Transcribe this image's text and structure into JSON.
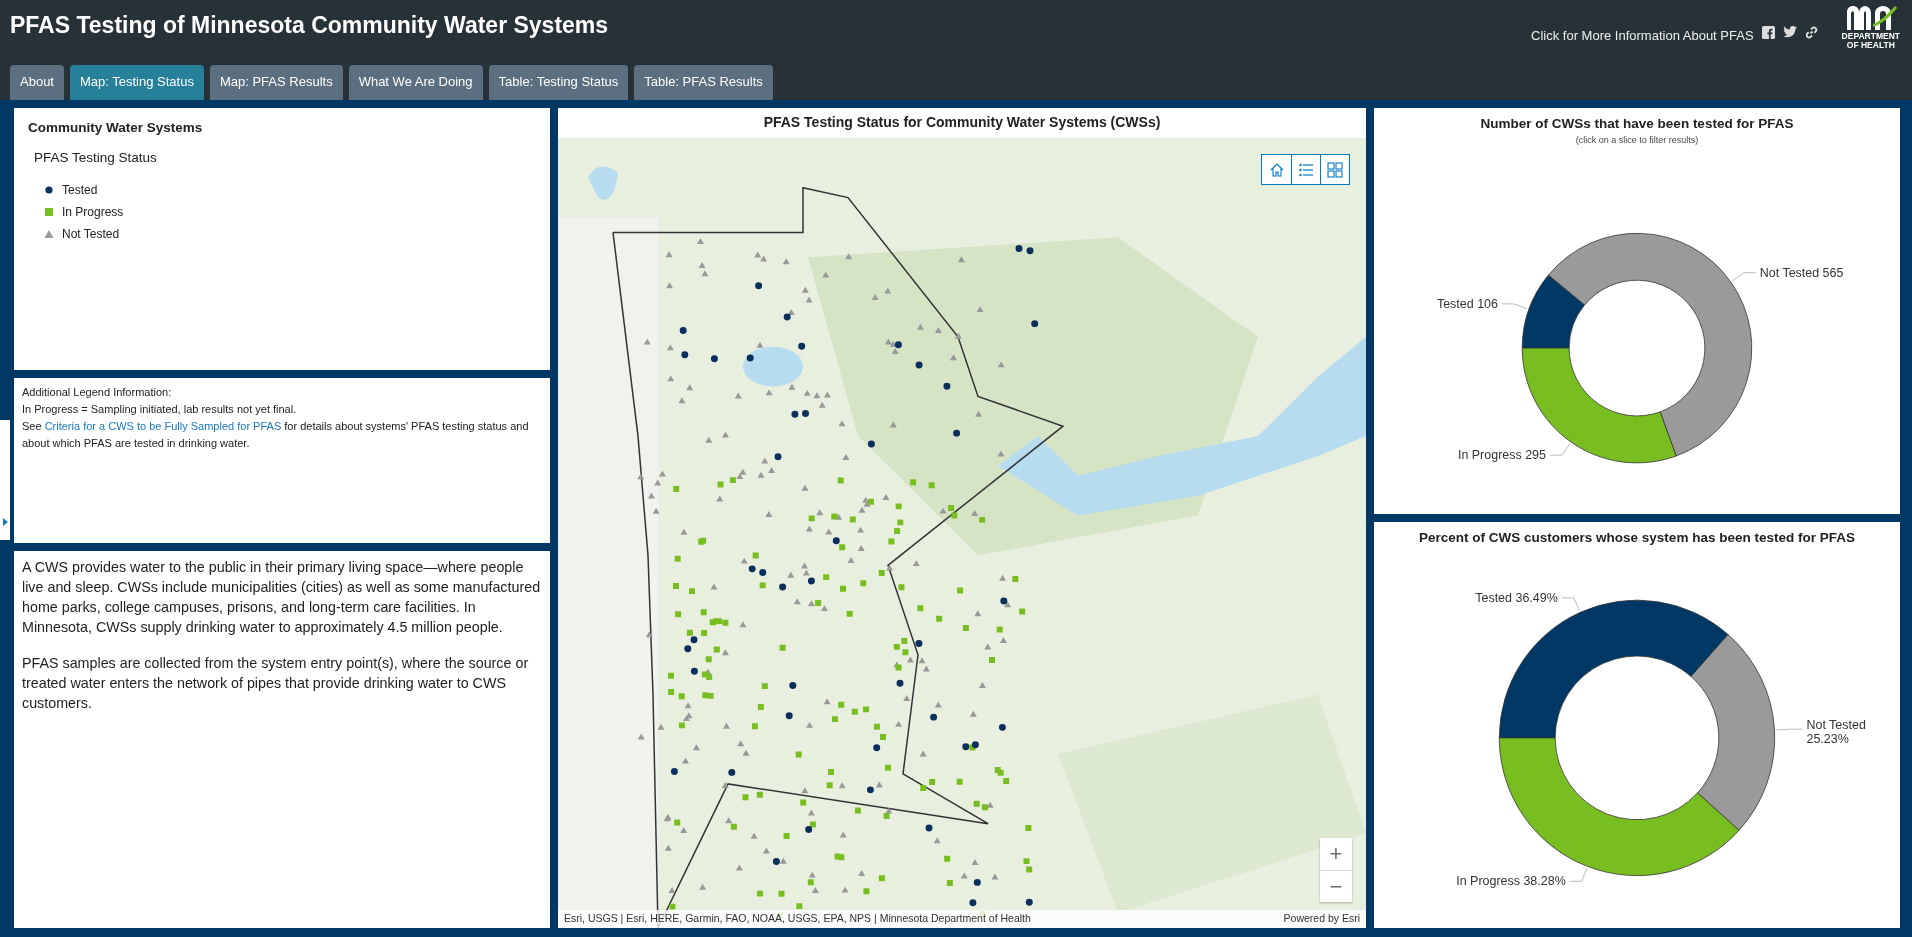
{
  "header": {
    "title": "PFAS Testing of Minnesota Community Water Systems",
    "info_link": "Click for More Information About PFAS",
    "logo_caption": [
      "DEPARTMENT",
      "OF HEALTH"
    ]
  },
  "tabs": [
    {
      "label": "About",
      "selected": false
    },
    {
      "label": "Map: Testing Status",
      "selected": true
    },
    {
      "label": "Map: PFAS Results",
      "selected": false
    },
    {
      "label": "What We Are Doing",
      "selected": false
    },
    {
      "label": "Table: Testing Status",
      "selected": false
    },
    {
      "label": "Table: PFAS Results",
      "selected": false
    }
  ],
  "legend": {
    "title": "Community Water Systems",
    "subtitle": "PFAS Testing Status",
    "items": [
      {
        "label": "Tested",
        "kind": "circle",
        "color": "#0b2f5c"
      },
      {
        "label": "In Progress",
        "kind": "square",
        "color": "#78be20"
      },
      {
        "label": "Not Tested",
        "kind": "triangle",
        "color": "#9a9a9a"
      }
    ]
  },
  "additional_info": {
    "heading": "Additional Legend Information:",
    "note": "In Progress = Sampling initiated, lab results not yet final.",
    "see_before": "See",
    "see_link": "Criteria for a CWS to be Fully Sampled for PFAS",
    "see_after": "for details about systems' PFAS testing status and about which PFAS are tested in drinking water."
  },
  "description": [
    "A CWS provides water to the public in their primary living space—where people live and sleep. CWSs include municipalities (cities) as well as some manufactured home parks, college campuses, prisons, and long-term care facilities. In Minnesota, CWSs supply drinking water to approximately 4.5 million people.",
    "PFAS samples are collected from the system entry point(s), where the source or treated water enters the network of pipes that provide drinking water to CWS customers."
  ],
  "map": {
    "title": "PFAS Testing Status for Community Water Systems (CWSs)",
    "kind": "picture",
    "attribution": "Esri, USGS | Esri, HERE, Garmin, FAO, NOAA, USGS, EPA, NPS | Minnesota Department of Health",
    "powered_by": "Powered by Esri",
    "zoom_in": "+",
    "zoom_out": "−"
  },
  "charts": [
    {
      "subtitle": "(click on a slice to filter results)",
      "chart_data": {
        "type": "donut",
        "title": "Number of CWSs that have been tested for PFAS",
        "categories": [
          "Tested",
          "Not Tested",
          "In Progress"
        ],
        "colors": [
          "#003865",
          "#9a9a9b",
          "#78be20"
        ],
        "values": [
          106,
          565,
          295
        ],
        "value_labels": [
          "106",
          "565",
          "295"
        ]
      }
    },
    {
      "chart_data": {
        "type": "donut",
        "title": "Percent of CWS customers whose system has been tested for PFAS",
        "categories": [
          "Tested",
          "Not Tested",
          "In Progress"
        ],
        "colors": [
          "#003865",
          "#9a9a9b",
          "#78be20"
        ],
        "values": [
          36.49,
          25.23,
          38.28
        ],
        "value_labels": [
          "36.49%",
          "25.23%",
          "38.28%"
        ]
      }
    }
  ]
}
